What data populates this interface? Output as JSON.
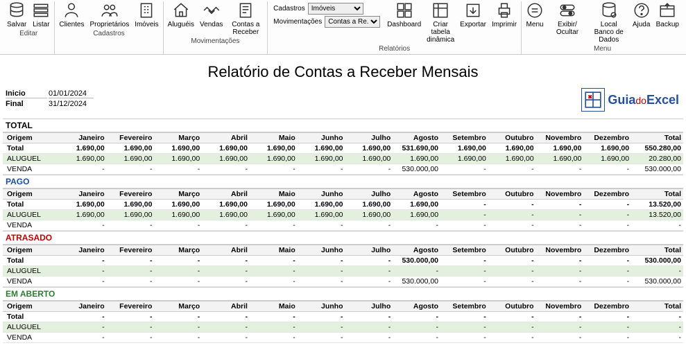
{
  "ribbon": {
    "groups": [
      {
        "label": "Editar",
        "buttons": [
          {
            "id": "salvar",
            "label": "Salvar",
            "icon": "db"
          },
          {
            "id": "listar",
            "label": "Listar",
            "icon": "list"
          }
        ]
      },
      {
        "label": "Cadastros",
        "buttons": [
          {
            "id": "clientes",
            "label": "Clientes",
            "icon": "person"
          },
          {
            "id": "proprietarios",
            "label": "Proprietários",
            "icon": "people"
          },
          {
            "id": "imoveis",
            "label": "Imóveis",
            "icon": "building"
          }
        ]
      },
      {
        "label": "Movimentações",
        "buttons": [
          {
            "id": "alugueis",
            "label": "Aluguéis",
            "icon": "house"
          },
          {
            "id": "vendas",
            "label": "Vendas",
            "icon": "handshake"
          },
          {
            "id": "contas-receber",
            "label": "Contas a Receber",
            "icon": "receipt"
          }
        ]
      },
      {
        "label": "Relatórios",
        "filters": [
          {
            "label": "Cadastros",
            "value": "Imóveis"
          },
          {
            "label": "Movimentações",
            "value": "Contas a Re..."
          }
        ],
        "buttons": [
          {
            "id": "dashboard",
            "label": "Dashboard",
            "icon": "dashboard"
          },
          {
            "id": "criar-tabela",
            "label": "Criar tabela dinâmica",
            "icon": "pivot"
          },
          {
            "id": "exportar",
            "label": "Exportar",
            "icon": "export"
          },
          {
            "id": "imprimir",
            "label": "Imprimir",
            "icon": "print"
          }
        ]
      },
      {
        "label": "Menu",
        "buttons": [
          {
            "id": "menu",
            "label": "Menu",
            "icon": "menu"
          },
          {
            "id": "exibir",
            "label": "Exibir/ Ocultar",
            "icon": "toggle"
          },
          {
            "id": "local-bd",
            "label": "Local Banco de Dados",
            "icon": "dbloc"
          },
          {
            "id": "ajuda",
            "label": "Ajuda",
            "icon": "help"
          },
          {
            "id": "backup",
            "label": "Backup",
            "icon": "backup"
          }
        ]
      }
    ]
  },
  "title": "Relatório de Contas a Receber Mensais",
  "period": {
    "inicio_label": "Inicio",
    "inicio": "01/01/2024",
    "final_label": "Final",
    "final": "31/12/2024"
  },
  "logo": {
    "guia": "Guia",
    "do": "do",
    "excel": "Excel"
  },
  "columns": [
    "Origem",
    "Janeiro",
    "Fevereiro",
    "Março",
    "Abril",
    "Maio",
    "Junho",
    "Julho",
    "Agosto",
    "Setembro",
    "Outubro",
    "Novembro",
    "Dezembro",
    "Total"
  ],
  "sections": [
    {
      "key": "total",
      "title": "TOTAL",
      "cls": "total",
      "rows": [
        {
          "label": "Total",
          "bold": true,
          "vals": [
            "1.690,00",
            "1.690,00",
            "1.690,00",
            "1.690,00",
            "1.690,00",
            "1.690,00",
            "1.690,00",
            "531.690,00",
            "1.690,00",
            "1.690,00",
            "1.690,00",
            "1.690,00",
            "550.280,00"
          ]
        },
        {
          "label": "ALUGUEL",
          "cls": "aluguel",
          "vals": [
            "1.690,00",
            "1.690,00",
            "1.690,00",
            "1.690,00",
            "1.690,00",
            "1.690,00",
            "1.690,00",
            "1.690,00",
            "1.690,00",
            "1.690,00",
            "1.690,00",
            "1.690,00",
            "20.280,00"
          ]
        },
        {
          "label": "VENDA",
          "vals": [
            "-",
            "-",
            "-",
            "-",
            "-",
            "-",
            "-",
            "530.000,00",
            "-",
            "-",
            "-",
            "-",
            "530.000,00"
          ]
        }
      ]
    },
    {
      "key": "pago",
      "title": "PAGO",
      "cls": "pago",
      "rows": [
        {
          "label": "Total",
          "bold": true,
          "vals": [
            "1.690,00",
            "1.690,00",
            "1.690,00",
            "1.690,00",
            "1.690,00",
            "1.690,00",
            "1.690,00",
            "1.690,00",
            "-",
            "-",
            "-",
            "-",
            "13.520,00"
          ]
        },
        {
          "label": "ALUGUEL",
          "cls": "aluguel",
          "vals": [
            "1.690,00",
            "1.690,00",
            "1.690,00",
            "1.690,00",
            "1.690,00",
            "1.690,00",
            "1.690,00",
            "1.690,00",
            "-",
            "-",
            "-",
            "-",
            "13.520,00"
          ]
        },
        {
          "label": "VENDA",
          "vals": [
            "-",
            "-",
            "-",
            "-",
            "-",
            "-",
            "-",
            "-",
            "-",
            "-",
            "-",
            "-",
            "-"
          ]
        }
      ]
    },
    {
      "key": "atrasado",
      "title": "ATRASADO",
      "cls": "atrasado",
      "rows": [
        {
          "label": "Total",
          "bold": true,
          "vals": [
            "-",
            "-",
            "-",
            "-",
            "-",
            "-",
            "-",
            "530.000,00",
            "-",
            "-",
            "-",
            "-",
            "530.000,00"
          ]
        },
        {
          "label": "ALUGUEL",
          "cls": "aluguel",
          "vals": [
            "-",
            "-",
            "-",
            "-",
            "-",
            "-",
            "-",
            "-",
            "-",
            "-",
            "-",
            "-",
            "-"
          ]
        },
        {
          "label": "VENDA",
          "vals": [
            "-",
            "-",
            "-",
            "-",
            "-",
            "-",
            "-",
            "530.000,00",
            "-",
            "-",
            "-",
            "-",
            "530.000,00"
          ]
        }
      ]
    },
    {
      "key": "emaberto",
      "title": "EM ABERTO",
      "cls": "emaberto",
      "rows": [
        {
          "label": "Total",
          "bold": true,
          "vals": [
            "-",
            "-",
            "-",
            "-",
            "-",
            "-",
            "-",
            "-",
            "-",
            "-",
            "-",
            "-",
            "-"
          ]
        },
        {
          "label": "ALUGUEL",
          "cls": "aluguel",
          "vals": [
            "-",
            "-",
            "-",
            "-",
            "-",
            "-",
            "-",
            "-",
            "-",
            "-",
            "-",
            "-",
            "-"
          ]
        },
        {
          "label": "VENDA",
          "vals": [
            "-",
            "-",
            "-",
            "-",
            "-",
            "-",
            "-",
            "-",
            "-",
            "-",
            "-",
            "-",
            "-"
          ]
        }
      ]
    }
  ]
}
